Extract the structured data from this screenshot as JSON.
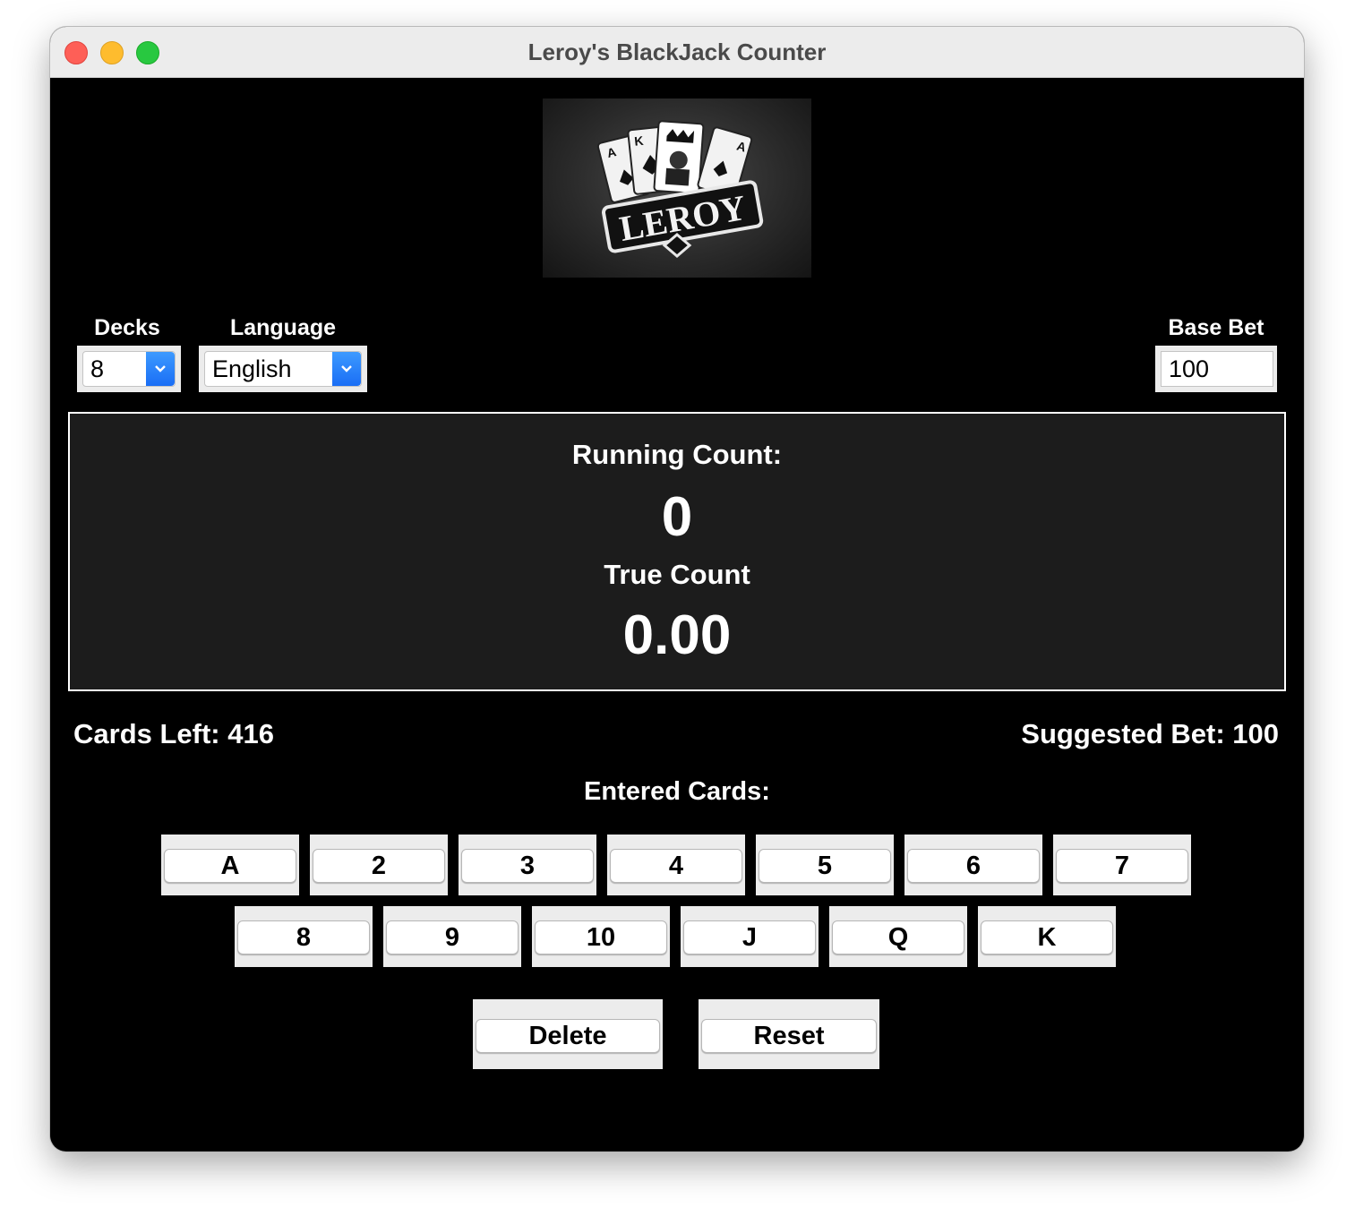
{
  "window": {
    "title": "Leroy's BlackJack Counter"
  },
  "logo": {
    "text": "LEROY",
    "cards": [
      "A",
      "K",
      "A"
    ]
  },
  "controls": {
    "decks_label": "Decks",
    "decks_value": "8",
    "language_label": "Language",
    "language_value": "English",
    "base_bet_label": "Base Bet",
    "base_bet_value": "100"
  },
  "counter": {
    "running_label": "Running Count:",
    "running_value": "0",
    "true_label": "True Count",
    "true_value": "0.00"
  },
  "stats": {
    "cards_left": "Cards Left: 416",
    "suggested_bet": "Suggested Bet: 100"
  },
  "entered_cards_label": "Entered Cards:",
  "card_buttons_row1": [
    "A",
    "2",
    "3",
    "4",
    "5",
    "6",
    "7"
  ],
  "card_buttons_row2": [
    "8",
    "9",
    "10",
    "J",
    "Q",
    "K"
  ],
  "actions": {
    "delete": "Delete",
    "reset": "Reset"
  },
  "colors": {
    "window_bg": "#000000",
    "panel_bg": "#1c1c1c",
    "accent": "#1a6ef5"
  }
}
